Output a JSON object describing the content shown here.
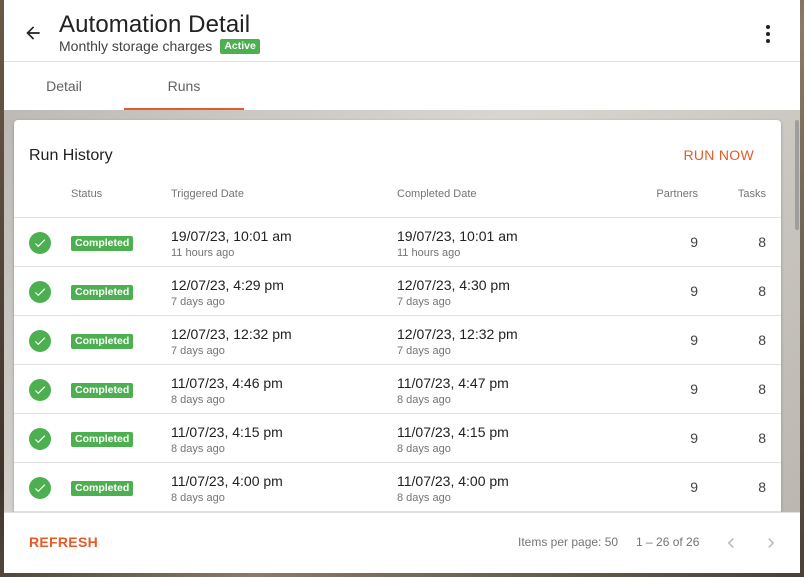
{
  "header": {
    "title": "Automation Detail",
    "subtitle": "Monthly storage charges",
    "status": "Active",
    "back_icon": "arrow-left-icon",
    "menu_icon": "more-vertical-icon"
  },
  "tabs": [
    {
      "label": "Detail",
      "active": false
    },
    {
      "label": "Runs",
      "active": true
    }
  ],
  "card": {
    "title": "Run History",
    "run_now_label": "RUN NOW"
  },
  "table": {
    "headers": {
      "status": "Status",
      "triggered": "Triggered Date",
      "completed": "Completed Date",
      "partners": "Partners",
      "tasks": "Tasks"
    },
    "rows": [
      {
        "status": "Completed",
        "triggered": "19/07/23, 10:01 am",
        "triggered_ago": "11 hours ago",
        "completed": "19/07/23, 10:01 am",
        "completed_ago": "11 hours ago",
        "partners": "9",
        "tasks": "8"
      },
      {
        "status": "Completed",
        "triggered": "12/07/23, 4:29 pm",
        "triggered_ago": "7 days ago",
        "completed": "12/07/23, 4:30 pm",
        "completed_ago": "7 days ago",
        "partners": "9",
        "tasks": "8"
      },
      {
        "status": "Completed",
        "triggered": "12/07/23, 12:32 pm",
        "triggered_ago": "7 days ago",
        "completed": "12/07/23, 12:32 pm",
        "completed_ago": "7 days ago",
        "partners": "9",
        "tasks": "8"
      },
      {
        "status": "Completed",
        "triggered": "11/07/23, 4:46 pm",
        "triggered_ago": "8 days ago",
        "completed": "11/07/23, 4:47 pm",
        "completed_ago": "8 days ago",
        "partners": "9",
        "tasks": "8"
      },
      {
        "status": "Completed",
        "triggered": "11/07/23, 4:15 pm",
        "triggered_ago": "8 days ago",
        "completed": "11/07/23, 4:15 pm",
        "completed_ago": "8 days ago",
        "partners": "9",
        "tasks": "8"
      },
      {
        "status": "Completed",
        "triggered": "11/07/23, 4:00 pm",
        "triggered_ago": "8 days ago",
        "completed": "11/07/23, 4:00 pm",
        "completed_ago": "8 days ago",
        "partners": "9",
        "tasks": "8"
      }
    ]
  },
  "footer": {
    "refresh_label": "REFRESH",
    "items_per_page": "Items per page: 50",
    "range": "1 – 26 of 26"
  },
  "colors": {
    "accent": "#e65a28",
    "success": "#4caf50"
  }
}
